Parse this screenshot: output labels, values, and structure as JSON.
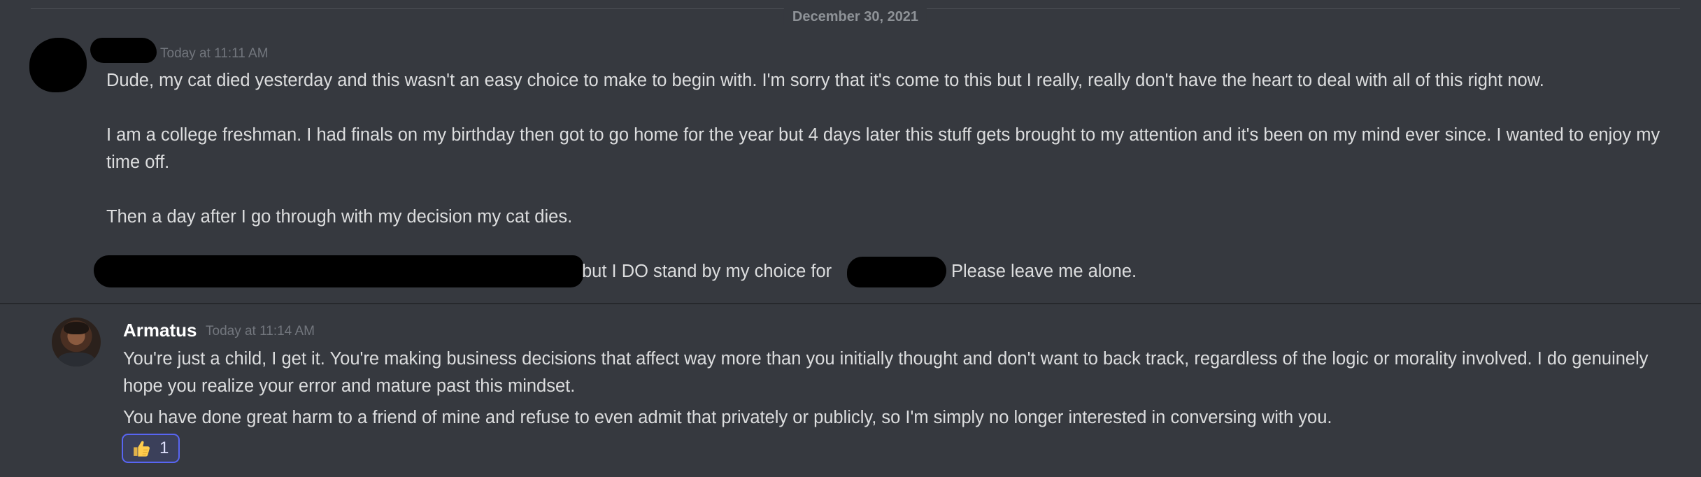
{
  "divider": {
    "date_label": "December 30, 2021"
  },
  "message_1": {
    "author": "",
    "timestamp": "Today at 11:11 AM",
    "paragraphs": [
      "Dude, my cat died yesterday and this wasn't an easy choice to make to begin with. I'm sorry that it's come to this but I really, really don't have the heart to deal with all of this right now.",
      "I am a college freshman. I had finals on my birthday then got to go home for the year but 4 days later this stuff gets brought to my attention and it's been on my mind ever since. I wanted to enjoy my time off.",
      "Then a day after I go through with my decision my cat dies."
    ],
    "last_line_segment_1": "but I DO stand by my choice for",
    "last_line_segment_2": "Please leave me alone."
  },
  "message_2": {
    "author": "Armatus",
    "timestamp": "Today at 11:14 AM",
    "paragraphs": [
      "You're just a child, I get it.  You're making business decisions that affect way more than you initially thought and don't want to back track, regardless of the logic or morality involved.  I do genuinely hope you realize your error and mature past this mindset.",
      "You have done great harm to a friend of mine and refuse to even admit that privately or publicly, so I'm simply no longer interested in conversing with you."
    ],
    "reaction": {
      "emoji": "thumbs-up-icon",
      "count": "1"
    }
  },
  "colors": {
    "background": "#36393f",
    "text": "#dcddde",
    "muted": "#72767d",
    "username": "#ffffff",
    "reaction_border": "#5865f2",
    "reaction_bg": "#3b405a"
  }
}
